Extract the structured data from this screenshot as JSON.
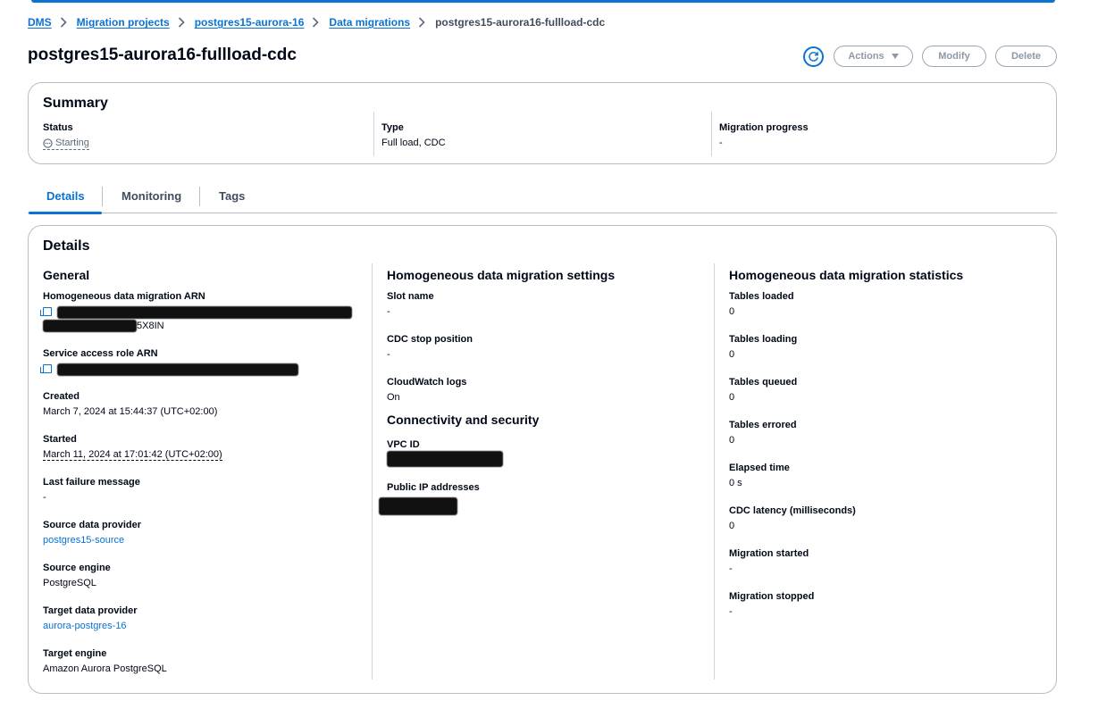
{
  "breadcrumb": {
    "items": [
      "DMS",
      "Migration projects",
      "postgres15-aurora-16",
      "Data migrations"
    ],
    "current": "postgres15-aurora16-fullload-cdc"
  },
  "header": {
    "title": "postgres15-aurora16-fullload-cdc",
    "actions_label": "Actions",
    "modify_label": "Modify",
    "delete_label": "Delete"
  },
  "summary": {
    "title": "Summary",
    "status_label": "Status",
    "status_value": "Starting",
    "type_label": "Type",
    "type_value": "Full load, CDC",
    "progress_label": "Migration progress",
    "progress_value": "-"
  },
  "tabs": [
    "Details",
    "Monitoring",
    "Tags"
  ],
  "details": {
    "title": "Details",
    "general": {
      "heading": "General",
      "arn_label": "Homogeneous data migration ARN",
      "arn_tail": "5X8IN",
      "role_label": "Service access role ARN",
      "created_label": "Created",
      "created_value": "March 7, 2024 at 15:44:37 (UTC+02:00)",
      "started_label": "Started",
      "started_value": "March 11, 2024 at 17:01:42 (UTC+02:00)",
      "failure_label": "Last failure message",
      "failure_value": "-",
      "source_provider_label": "Source data provider",
      "source_provider_value": "postgres15-source",
      "source_engine_label": "Source engine",
      "source_engine_value": "PostgreSQL",
      "target_provider_label": "Target data provider",
      "target_provider_value": "aurora-postgres-16",
      "target_engine_label": "Target engine",
      "target_engine_value": "Amazon Aurora PostgreSQL"
    },
    "settings": {
      "heading": "Homogeneous data migration settings",
      "slot_label": "Slot name",
      "slot_value": "-",
      "cdc_stop_label": "CDC stop position",
      "cdc_stop_value": "-",
      "logs_label": "CloudWatch logs",
      "logs_value": "On",
      "conn_heading": "Connectivity and security",
      "vpc_label": "VPC ID",
      "ip_label": "Public IP addresses"
    },
    "stats": {
      "heading": "Homogeneous data migration statistics",
      "items": [
        {
          "label": "Tables loaded",
          "value": "0"
        },
        {
          "label": "Tables loading",
          "value": "0"
        },
        {
          "label": "Tables queued",
          "value": "0"
        },
        {
          "label": "Tables errored",
          "value": "0"
        },
        {
          "label": "Elapsed time",
          "value": "0 s"
        },
        {
          "label": "CDC latency (milliseconds)",
          "value": "0"
        },
        {
          "label": "Migration started",
          "value": "-"
        },
        {
          "label": "Migration stopped",
          "value": "-"
        }
      ]
    }
  },
  "colors": {
    "accent": "#0972d3",
    "text": "#000716",
    "border": "#b6bec9"
  }
}
